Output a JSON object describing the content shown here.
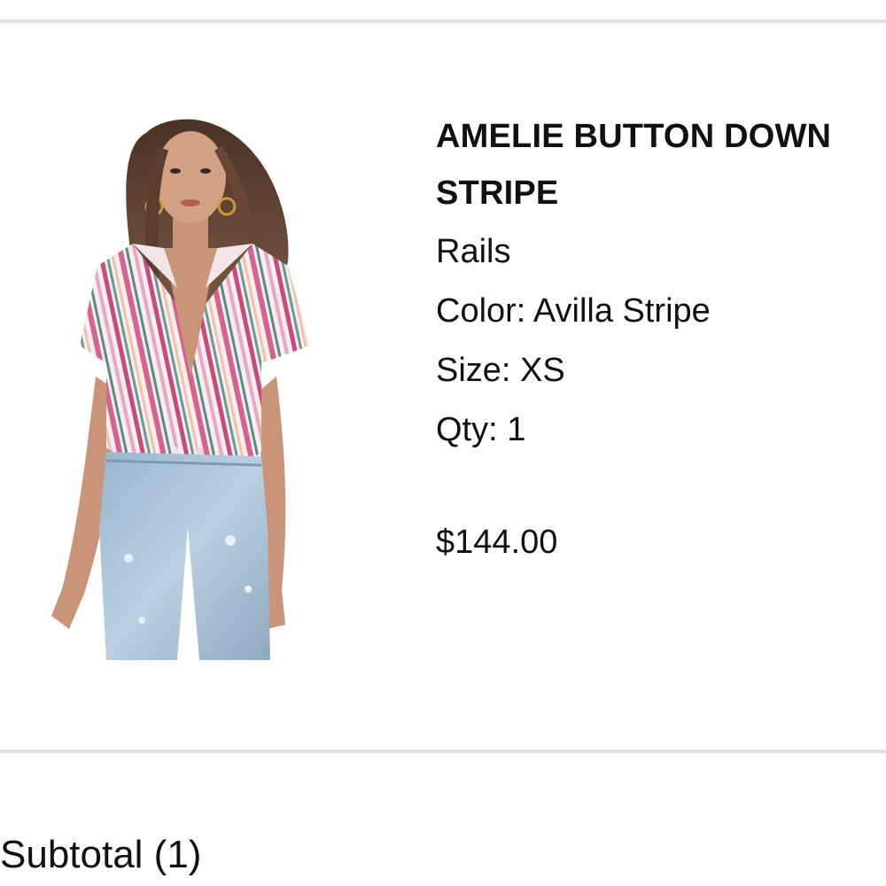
{
  "cart_item": {
    "title_line_1": "AMELIE BUTTON DOWN",
    "title_line_2": "STRIPE",
    "brand": "Rails",
    "color_label": "Color:",
    "color_value": "Avilla Stripe",
    "size_label": "Size:",
    "size_value": "XS",
    "qty_label": "Qty:",
    "qty_value": "1",
    "price": "$144.00",
    "image_icon": "product-photo"
  },
  "summary": {
    "subtotal_label": "Subtotal (1)"
  },
  "colors": {
    "divider": "#e3e3e3",
    "text": "#111111",
    "stripe_pink": "#d8628f",
    "stripe_teal": "#5d8a86",
    "denim": "#a9c3d9"
  }
}
